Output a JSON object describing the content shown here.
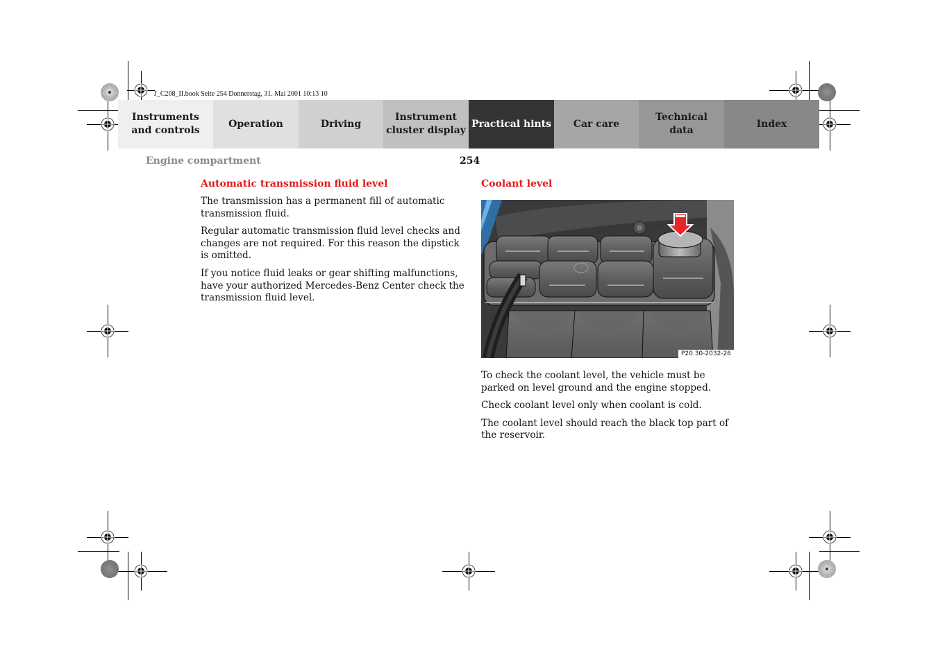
{
  "print_header": "J_C208_II.book  Seite 254  Donnerstag, 31. Mai 2001  10:13 10",
  "nav": {
    "tabs": [
      {
        "label": "Instruments and controls",
        "line1": "Instruments",
        "line2": "and controls",
        "color": "#efefef",
        "active": false
      },
      {
        "label": "Operation",
        "line1": "Operation",
        "line2": "",
        "color": "#e0e0e0",
        "active": false
      },
      {
        "label": "Driving",
        "line1": "Driving",
        "line2": "",
        "color": "#d0d0d0",
        "active": false
      },
      {
        "label": "Instrument cluster display",
        "line1": "Instrument",
        "line2": "cluster display",
        "color": "#c0c0c0",
        "active": false
      },
      {
        "label": "Practical hints",
        "line1": "Practical hints",
        "line2": "",
        "color": "#343434",
        "active": true
      },
      {
        "label": "Car care",
        "line1": "Car care",
        "line2": "",
        "color": "#a6a6a6",
        "active": false
      },
      {
        "label": "Technical data",
        "line1": "Technical",
        "line2": "data",
        "color": "#979797",
        "active": false
      },
      {
        "label": "Index",
        "line1": "Index",
        "line2": "",
        "color": "#888888",
        "active": false
      }
    ]
  },
  "page": {
    "section_title": "Engine compartment",
    "page_number": "254"
  },
  "left_column": {
    "heading": "Automatic transmission fluid level",
    "paragraphs": [
      "The transmission has a permanent fill of automatic transmission fluid.",
      "Regular automatic transmission fluid level checks and changes are not required. For this reason the dipstick is omitted.",
      "If you notice fluid leaks or gear shifting malfunctions, have your authorized Mercedes-Benz Center check the transmission fluid level."
    ]
  },
  "right_column": {
    "heading": "Coolant level",
    "figure": {
      "caption_code": "P20.30-2032-26",
      "description": "Coolant reservoir with red arrow pointing to the cap"
    },
    "paragraphs": [
      "To check the coolant level, the vehicle must be parked on level ground and the engine stopped.",
      "Check coolant level only when coolant is cold.",
      "The coolant level should reach the black top part of the reservoir."
    ]
  },
  "colors": {
    "heading_red": "#e01b1b",
    "section_gray": "#8a8a8a",
    "arrow_red": "#e8262a"
  }
}
